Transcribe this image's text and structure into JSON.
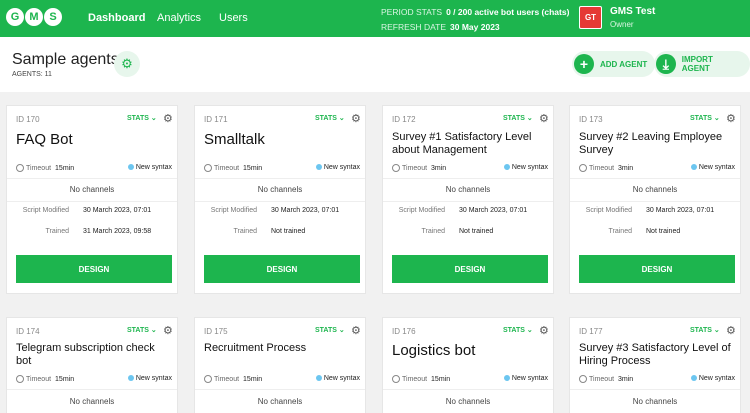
{
  "app": {
    "logo_letters": [
      "G",
      "M",
      "S"
    ]
  },
  "nav": {
    "items": [
      "Dashboard",
      "Analytics",
      "Users"
    ]
  },
  "stats": {
    "period_label": "PERIOD STATS",
    "period_value": "0 / 200 active bot users (chats)",
    "refresh_label": "REFRESH DATE",
    "refresh_value": "30 May 2023"
  },
  "user": {
    "initials": "GT",
    "name": "GMS Test",
    "role": "Owner"
  },
  "page": {
    "title": "Sample agents",
    "count": "AGENTS: 11",
    "add_label": "ADD AGENT",
    "import_label": "IMPORT AGENT"
  },
  "labels": {
    "stats": "STATS",
    "timeout": "Timeout",
    "new_syntax": "New syntax",
    "no_channels": "No channels",
    "script_modified": "Script Modified",
    "trained": "Trained",
    "design": "DESIGN"
  },
  "agents": [
    {
      "id": "ID 170",
      "title": "FAQ Bot",
      "timeout": "15min",
      "modified": "30 March 2023, 07:01",
      "trained": "31 March 2023, 09:58"
    },
    {
      "id": "ID 171",
      "title": "Smalltalk",
      "timeout": "15min",
      "modified": "30 March 2023, 07:01",
      "trained": "Not trained"
    },
    {
      "id": "ID 172",
      "title": "Survey #1 Satisfactory Level about Management",
      "timeout": "3min",
      "modified": "30 March 2023, 07:01",
      "trained": "Not trained"
    },
    {
      "id": "ID 173",
      "title": "Survey #2 Leaving Employee Survey",
      "timeout": "3min",
      "modified": "30 March 2023, 07:01",
      "trained": "Not trained"
    },
    {
      "id": "ID 174",
      "title": "Telegram subscription check bot",
      "timeout": "15min"
    },
    {
      "id": "ID 175",
      "title": "Recruitment Process",
      "timeout": "15min"
    },
    {
      "id": "ID 176",
      "title": "Logistics bot",
      "timeout": "15min"
    },
    {
      "id": "ID 177",
      "title": "Survey #3 Satisfactory Level of Hiring Process",
      "timeout": "3min"
    }
  ],
  "colors": {
    "brand": "#1db54e",
    "avatar": "#e53935",
    "syntax_dot": "#6cc6f0"
  }
}
